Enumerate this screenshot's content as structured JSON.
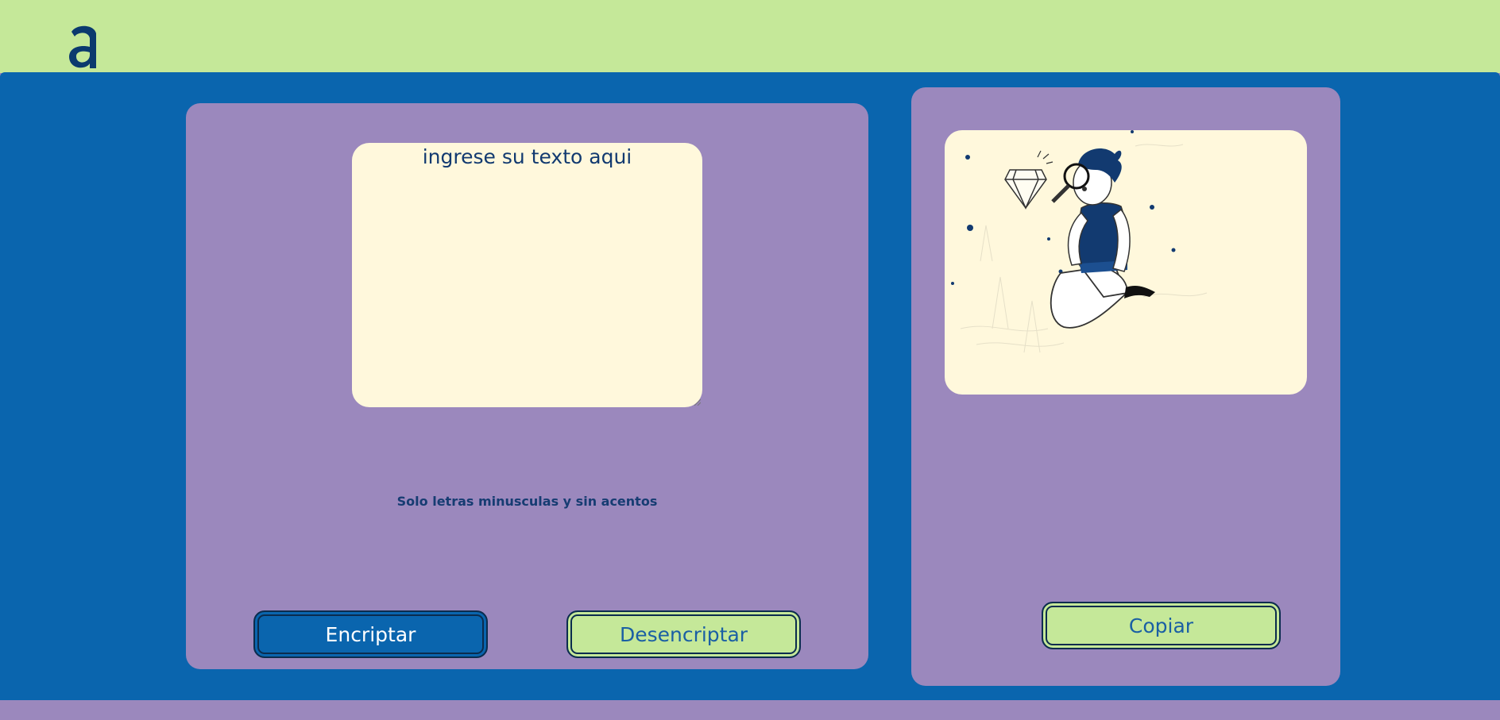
{
  "header": {
    "logo_icon": "alura-a-logo-icon"
  },
  "input": {
    "text": "ingrese su texto aqui"
  },
  "hint": {
    "text": "Solo letras minusculas y sin acentos"
  },
  "buttons": {
    "encrypt_label": "Encriptar",
    "decrypt_label": "Desencriptar",
    "copy_label": "Copiar"
  },
  "illustration": {
    "icon": "person-with-magnifier-and-diamond-icon"
  },
  "colors": {
    "header_bg": "#c5e899",
    "main_bg": "#0a65ae",
    "panel_bg": "#9b88bd",
    "textarea_bg": "#fff8dc",
    "text_dark": "#123a70"
  }
}
